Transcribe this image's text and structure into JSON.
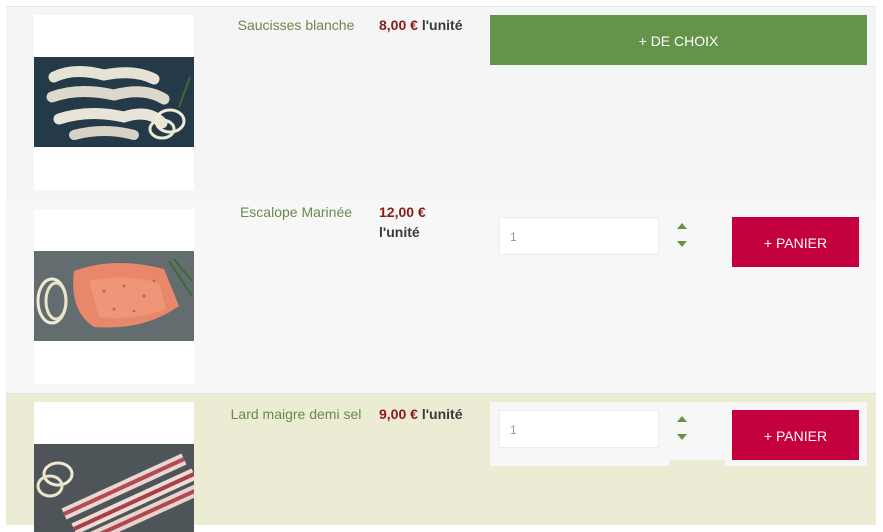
{
  "products": [
    {
      "name": "Saucisses blanche",
      "price": "8,00 €",
      "unit": "l'unité",
      "action_label": "+ DE CHOIX"
    },
    {
      "name": "Escalope Marinée",
      "price": "12,00 €",
      "unit": "l'unité",
      "quantity": "1",
      "action_label": "+ PANIER"
    },
    {
      "name": "Lard maigre demi sel",
      "price": "9,00 €",
      "unit": "l'unité",
      "quantity": "1",
      "action_label": "+ PANIER"
    }
  ],
  "colors": {
    "name_text": "#6a8a4a",
    "price": "#8b1a1a",
    "choice_button": "#64934a",
    "cart_button": "#c5003e",
    "highlight_row": "#ecebd4"
  },
  "icons": {
    "qty_up": "caret-up-icon",
    "qty_down": "caret-down-icon"
  }
}
